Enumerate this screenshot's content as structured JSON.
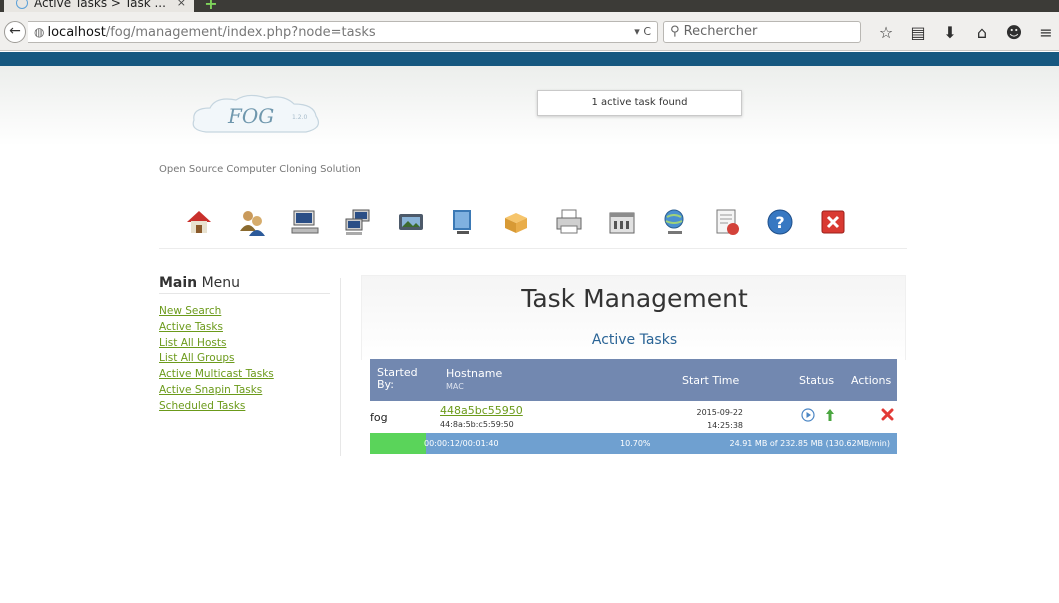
{
  "browser": {
    "tab_title": "Active Tasks > Task ...",
    "tab_close": "×",
    "new_tab": "+",
    "back": "←",
    "url_host": "localhost",
    "url_path": "/fog/management/index.php?node=tasks",
    "url_tail": "▾ C",
    "search_placeholder": "Rechercher",
    "toolbar_icons": [
      "☆",
      "▤",
      "⬇",
      "⌂",
      "☻",
      "≡"
    ]
  },
  "header": {
    "logo_text": "FOG",
    "logo_version": "1.2.0",
    "tagline": "Open Source Computer Cloning Solution",
    "notice": "1 active task found"
  },
  "nav_icons": [
    "home-icon",
    "users-icon",
    "host-icon",
    "groups-icon",
    "image-icon",
    "storage-icon",
    "snapin-icon",
    "printer-icon",
    "service-icon",
    "report-icon",
    "tasks-icon",
    "log-icon",
    "help-icon",
    "logout-icon"
  ],
  "sidebar": {
    "title_bold": "Main",
    "title_rest": " Menu",
    "items": [
      {
        "label": "New Search"
      },
      {
        "label": "Active Tasks"
      },
      {
        "label": "List All Hosts"
      },
      {
        "label": "List All Groups"
      },
      {
        "label": "Active Multicast Tasks"
      },
      {
        "label": "Active Snapin Tasks"
      },
      {
        "label": "Scheduled Tasks"
      }
    ]
  },
  "main": {
    "title": "Task Management",
    "subtitle": "Active Tasks"
  },
  "table": {
    "headers": {
      "started_by_1": "Started",
      "started_by_2": "By:",
      "hostname": "Hostname",
      "mac": "MAC",
      "start_time": "Start Time",
      "status": "Status",
      "actions": "Actions"
    },
    "rows": [
      {
        "started_by": "fog",
        "hostname": "448a5bc55950",
        "mac": "44:8a:5b:c5:59:50",
        "date": "2015-09-22",
        "time": "14:25:38",
        "progress_fraction": 0.107,
        "elapsed": "00:00:12/00:01:40",
        "percent": "10.70%",
        "transfer": "24.91 MB of 232.85 MB (130.62MB/min)"
      }
    ]
  },
  "colors": {
    "accent_bar": "#165880",
    "link": "#6b9a1a",
    "table_header": "#7288b0",
    "progress_bg": "#6fa0d0",
    "progress_fill": "#5ad45a"
  }
}
